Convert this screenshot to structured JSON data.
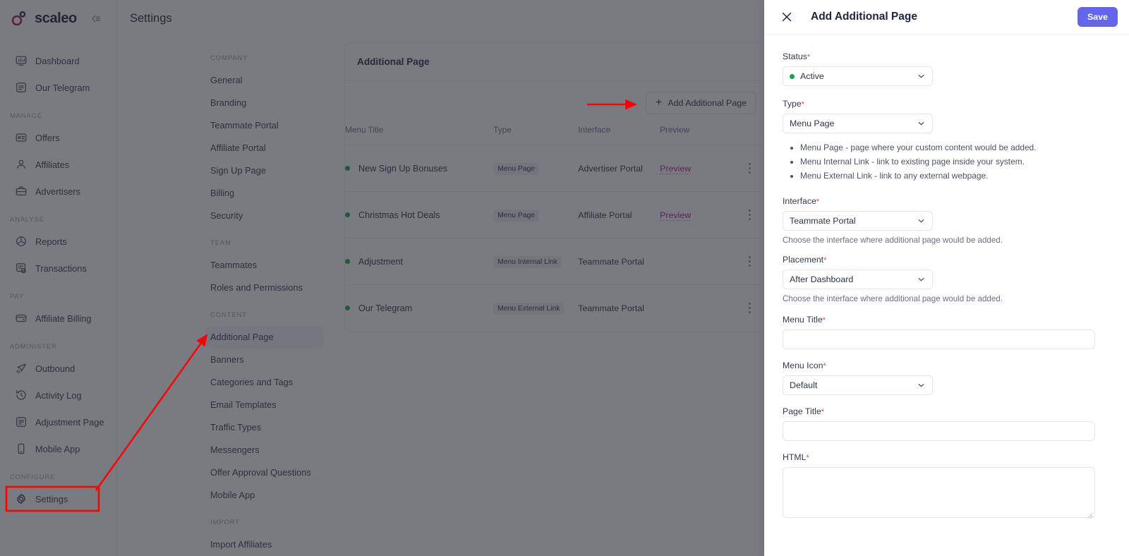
{
  "brand": {
    "name": "scaleo",
    "collapse_icon": "collapse-sidebar-icon"
  },
  "header": {
    "page_title": "Settings"
  },
  "sidebar": {
    "groups": [
      {
        "label": "",
        "items": [
          {
            "label": "Dashboard",
            "icon": "dashboard-icon"
          },
          {
            "label": "Our Telegram",
            "icon": "document-icon"
          }
        ]
      },
      {
        "label": "MANAGE",
        "items": [
          {
            "label": "Offers",
            "icon": "offers-card-icon"
          },
          {
            "label": "Affiliates",
            "icon": "user-icon"
          },
          {
            "label": "Advertisers",
            "icon": "briefcase-icon"
          }
        ]
      },
      {
        "label": "ANALYSE",
        "items": [
          {
            "label": "Reports",
            "icon": "pie-chart-icon"
          },
          {
            "label": "Transactions",
            "icon": "transactions-icon"
          }
        ]
      },
      {
        "label": "PAY",
        "items": [
          {
            "label": "Affiliate Billing",
            "icon": "credit-card-icon"
          }
        ]
      },
      {
        "label": "ADMINISTER",
        "items": [
          {
            "label": "Outbound",
            "icon": "paper-plane-icon"
          },
          {
            "label": "Activity Log",
            "icon": "history-clock-icon"
          },
          {
            "label": "Adjustment Page",
            "icon": "document-icon"
          },
          {
            "label": "Mobile App",
            "icon": "mobile-phone-icon"
          }
        ]
      },
      {
        "label": "CONFIGURE",
        "items": [
          {
            "label": "Settings",
            "icon": "gear-icon"
          }
        ]
      }
    ]
  },
  "subnav": {
    "groups": [
      {
        "label": "COMPANY",
        "items": [
          {
            "label": "General"
          },
          {
            "label": "Branding"
          },
          {
            "label": "Teammate Portal"
          },
          {
            "label": "Affiliate Portal"
          },
          {
            "label": "Sign Up Page"
          },
          {
            "label": "Billing"
          },
          {
            "label": "Security"
          }
        ]
      },
      {
        "label": "TEAM",
        "items": [
          {
            "label": "Teammates"
          },
          {
            "label": "Roles and Permissions"
          }
        ]
      },
      {
        "label": "CONTENT",
        "items": [
          {
            "label": "Additional Page",
            "active": true
          },
          {
            "label": "Banners"
          },
          {
            "label": "Categories and Tags"
          },
          {
            "label": "Email Templates"
          },
          {
            "label": "Traffic Types"
          },
          {
            "label": "Messengers"
          },
          {
            "label": "Offer Approval Questions"
          },
          {
            "label": "Mobile App"
          }
        ]
      },
      {
        "label": "IMPORT",
        "items": [
          {
            "label": "Import Affiliates"
          }
        ]
      }
    ]
  },
  "main": {
    "card_title": "Additional Page",
    "add_button": "Add Additional Page",
    "columns": [
      "Menu Title",
      "Type",
      "Interface",
      "Preview"
    ],
    "rows": [
      {
        "status": "active",
        "title": "New Sign Up Bonuses",
        "type": "Menu Page",
        "interface": "Advertiser Portal",
        "preview": "Preview"
      },
      {
        "status": "active",
        "title": "Christmas Hot Deals",
        "type": "Menu Page",
        "interface": "Affiliate Portal",
        "preview": "Preview"
      },
      {
        "status": "active",
        "title": "Adjustment",
        "type": "Menu Internal Link",
        "interface": "Teammate Portal",
        "preview": ""
      },
      {
        "status": "active",
        "title": "Our Telegram",
        "type": "Menu External Link",
        "interface": "Teammate Portal",
        "preview": ""
      }
    ]
  },
  "drawer": {
    "title": "Add Additional Page",
    "close_label": "close-icon",
    "save_label": "Save",
    "fields": {
      "status": {
        "label": "Status",
        "required": "*",
        "value": "Active"
      },
      "type": {
        "label": "Type",
        "required": "*",
        "value": "Menu Page"
      },
      "interface": {
        "label": "Interface",
        "required": "*",
        "value": "Teammate Portal",
        "hint": "Choose the interface where additional page would be added."
      },
      "placement": {
        "label": "Placement",
        "required": "*",
        "value": "After Dashboard",
        "hint": "Choose the interface where additional page would be added."
      },
      "menu_title": {
        "label": "Menu Title",
        "required": "*",
        "value": "",
        "placeholder": ""
      },
      "menu_icon": {
        "label": "Menu Icon",
        "required": "*",
        "value": "Default"
      },
      "page_title": {
        "label": "Page Title",
        "required": "*",
        "value": "",
        "placeholder": ""
      },
      "html": {
        "label": "HTML",
        "required": "*",
        "value": "",
        "placeholder": ""
      }
    },
    "type_bullets": [
      "Menu Page - page where your custom content would be added.",
      "Menu Internal Link - link to existing page inside your system.",
      "Menu External Link - link to any external webpage."
    ]
  },
  "annotations": {
    "color": "#ff0000",
    "highlight_box_target": "Settings",
    "arrow_to_additional_page": true,
    "arrow_to_add_button": true
  },
  "colors": {
    "accent": "#6366e8",
    "preview_link": "#a0219b",
    "status_dot": "#16a34a",
    "annotation": "#ff0000",
    "brand_mark": "#b3144f"
  }
}
